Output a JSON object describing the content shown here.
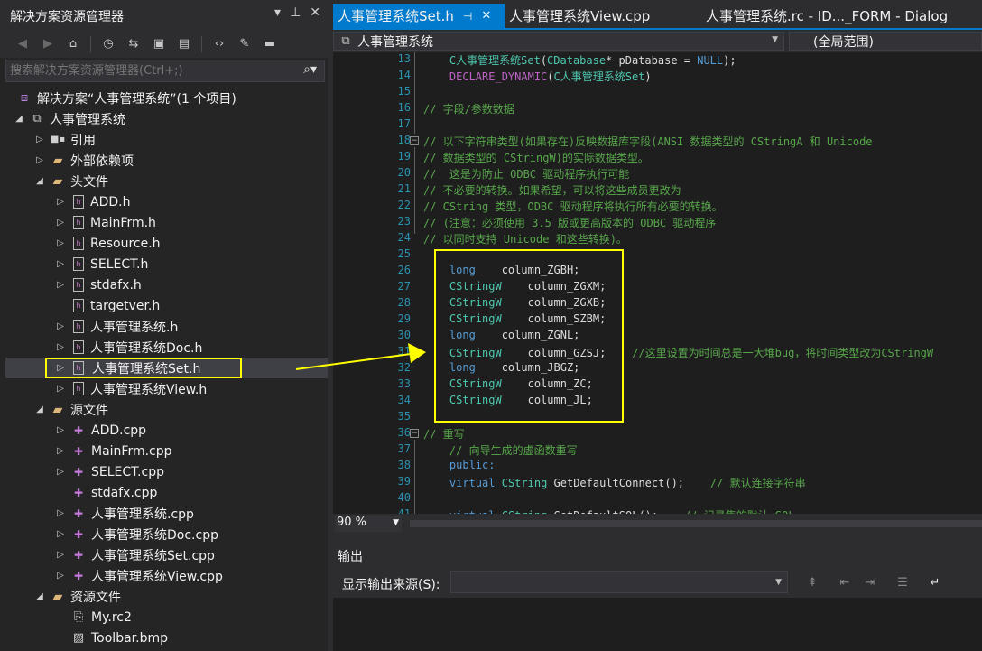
{
  "solution_explorer": {
    "title": "解决方案资源管理器",
    "title_buttons": [
      "▾",
      "⊥",
      "✕"
    ],
    "search_placeholder": "搜索解决方案资源管理器(Ctrl+;)",
    "tree": [
      {
        "label": "解决方案“人事管理系统”(1 个项目)",
        "icon": "solution-icon",
        "indent": 0,
        "expander": ""
      },
      {
        "label": "人事管理系统",
        "icon": "project-icon",
        "indent": 1,
        "expander": "◢"
      },
      {
        "label": "引用",
        "icon": "references-icon",
        "indent": 2,
        "expander": "▷"
      },
      {
        "label": "外部依赖项",
        "icon": "folder-icon",
        "indent": 2,
        "expander": "▷"
      },
      {
        "label": "头文件",
        "icon": "folder-icon",
        "indent": 2,
        "expander": "◢"
      },
      {
        "label": "ADD.h",
        "icon": "header-file-icon",
        "indent": 3,
        "expander": "▷"
      },
      {
        "label": "MainFrm.h",
        "icon": "header-file-icon",
        "indent": 3,
        "expander": "▷"
      },
      {
        "label": "Resource.h",
        "icon": "header-file-icon",
        "indent": 3,
        "expander": "▷"
      },
      {
        "label": "SELECT.h",
        "icon": "header-file-icon",
        "indent": 3,
        "expander": "▷"
      },
      {
        "label": "stdafx.h",
        "icon": "header-file-icon",
        "indent": 3,
        "expander": "▷"
      },
      {
        "label": "targetver.h",
        "icon": "header-file-icon",
        "indent": 3,
        "expander": ""
      },
      {
        "label": "人事管理系统.h",
        "icon": "header-file-icon",
        "indent": 3,
        "expander": "▷"
      },
      {
        "label": "人事管理系统Doc.h",
        "icon": "header-file-icon",
        "indent": 3,
        "expander": "▷"
      },
      {
        "label": "人事管理系统Set.h",
        "icon": "header-file-icon",
        "indent": 3,
        "expander": "▷",
        "selected": true
      },
      {
        "label": "人事管理系统View.h",
        "icon": "header-file-icon",
        "indent": 3,
        "expander": "▷"
      },
      {
        "label": "源文件",
        "icon": "folder-icon",
        "indent": 2,
        "expander": "◢"
      },
      {
        "label": "ADD.cpp",
        "icon": "cpp-file-icon",
        "indent": 3,
        "expander": "▷"
      },
      {
        "label": "MainFrm.cpp",
        "icon": "cpp-file-icon",
        "indent": 3,
        "expander": "▷"
      },
      {
        "label": "SELECT.cpp",
        "icon": "cpp-file-icon",
        "indent": 3,
        "expander": "▷"
      },
      {
        "label": "stdafx.cpp",
        "icon": "cpp-file-icon",
        "indent": 3,
        "expander": ""
      },
      {
        "label": "人事管理系统.cpp",
        "icon": "cpp-file-icon",
        "indent": 3,
        "expander": "▷"
      },
      {
        "label": "人事管理系统Doc.cpp",
        "icon": "cpp-file-icon",
        "indent": 3,
        "expander": "▷"
      },
      {
        "label": "人事管理系统Set.cpp",
        "icon": "cpp-file-icon",
        "indent": 3,
        "expander": "▷"
      },
      {
        "label": "人事管理系统View.cpp",
        "icon": "cpp-file-icon",
        "indent": 3,
        "expander": "▷"
      },
      {
        "label": "资源文件",
        "icon": "folder-icon",
        "indent": 2,
        "expander": "◢"
      },
      {
        "label": "My.rc2",
        "icon": "resource-file-icon",
        "indent": 3,
        "expander": ""
      },
      {
        "label": "Toolbar.bmp",
        "icon": "bitmap-file-icon",
        "indent": 3,
        "expander": ""
      }
    ]
  },
  "editor": {
    "tabs": [
      {
        "label": "人事管理系统Set.h",
        "active": true
      },
      {
        "label": "人事管理系统View.cpp",
        "active": false
      },
      {
        "label": "人事管理系统.rc - ID..._FORM - Dialog",
        "active": false
      }
    ],
    "nav_left": "人事管理系统",
    "nav_right": "(全局范围)",
    "zoom": "90 %",
    "lines": [
      {
        "n": "13",
        "t": "    C人事管理系统Set(CDatabase* pDatabase = NULL);",
        "c": "code"
      },
      {
        "n": "14",
        "t": "    DECLARE_DYNAMIC(C人事管理系统Set)",
        "c": "code"
      },
      {
        "n": "15",
        "t": "",
        "c": "code"
      },
      {
        "n": "16",
        "t": "// 字段/参数数据",
        "c": "cmt"
      },
      {
        "n": "17",
        "t": "",
        "c": "code"
      },
      {
        "n": "18",
        "t": "// 以下字符串类型(如果存在)反映数据库字段(ANSI 数据类型的 CStringA 和 Unicode",
        "c": "cmt"
      },
      {
        "n": "19",
        "t": "// 数据类型的 CStringW)的实际数据类型。",
        "c": "cmt"
      },
      {
        "n": "20",
        "t": "//  这是为防止 ODBC 驱动程序执行可能",
        "c": "cmt"
      },
      {
        "n": "21",
        "t": "// 不必要的转换。如果希望，可以将这些成员更改为",
        "c": "cmt"
      },
      {
        "n": "22",
        "t": "// CString 类型，ODBC 驱动程序将执行所有必要的转换。",
        "c": "cmt"
      },
      {
        "n": "23",
        "t": "// (注意：必须使用 3.5 版或更高版本的 ODBC 驱动程序",
        "c": "cmt"
      },
      {
        "n": "24",
        "t": "// 以同时支持 Unicode 和这些转换)。",
        "c": "cmt"
      },
      {
        "n": "25",
        "t": "",
        "c": "code"
      },
      {
        "n": "26",
        "t": "    long    column_ZGBH;",
        "c": "kwline"
      },
      {
        "n": "27",
        "t": "    CStringW    column_ZGXM;",
        "c": "tyline"
      },
      {
        "n": "28",
        "t": "    CStringW    column_ZGXB;",
        "c": "tyline"
      },
      {
        "n": "29",
        "t": "    CStringW    column_SZBM;",
        "c": "tyline"
      },
      {
        "n": "30",
        "t": "    long    column_ZGNL;",
        "c": "kwline"
      },
      {
        "n": "31",
        "t": "    CStringW    column_GZSJ;",
        "c": "tyline",
        "comment": "    //这里设置为时间总是一大堆bug，将时间类型改为CStringW"
      },
      {
        "n": "32",
        "t": "    long    column_JBGZ;",
        "c": "kwline"
      },
      {
        "n": "33",
        "t": "    CStringW    column_ZC;",
        "c": "tyline"
      },
      {
        "n": "34",
        "t": "    CStringW    column_JL;",
        "c": "tyline"
      },
      {
        "n": "35",
        "t": "",
        "c": "code"
      },
      {
        "n": "36",
        "t": "// 重写",
        "c": "cmt"
      },
      {
        "n": "37",
        "t": "    // 向导生成的虚函数重写",
        "c": "cmt"
      },
      {
        "n": "38",
        "t": "    public:",
        "c": "kwplain"
      },
      {
        "n": "39",
        "t": "    virtual CString GetDefaultConnect();",
        "c": "virt",
        "comment": "    // 默认连接字符串"
      },
      {
        "n": "40",
        "t": "",
        "c": "code"
      },
      {
        "n": "41",
        "t": "    virtual CString GetDefaultSQL();",
        "c": "virt",
        "comment": "    // 记录集的默认 SQL"
      }
    ]
  },
  "output": {
    "title": "输出",
    "source_label": "显示输出来源(S):",
    "source_value": ""
  },
  "colors": {
    "accent": "#007acc",
    "highlight": "#ffff00",
    "comment": "#57a64a",
    "keyword": "#569cd6",
    "type": "#4ec9b0",
    "line_number": "#2b91af"
  }
}
